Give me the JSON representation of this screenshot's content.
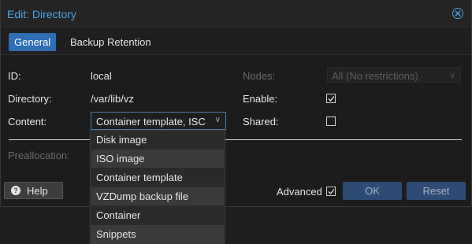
{
  "dialog": {
    "title": "Edit: Directory"
  },
  "tabs": [
    {
      "label": "General",
      "active": true
    },
    {
      "label": "Backup Retention",
      "active": false
    }
  ],
  "form": {
    "id_label": "ID:",
    "id_value": "local",
    "directory_label": "Directory:",
    "directory_value": "/var/lib/vz",
    "content_label": "Content:",
    "content_value": "Container template, ISC",
    "nodes_label": "Nodes:",
    "nodes_value": "All (No restrictions)",
    "enable_label": "Enable:",
    "enable_checked": true,
    "shared_label": "Shared:",
    "shared_checked": false,
    "preallocation_label": "Preallocation:"
  },
  "content_options": [
    "Disk image",
    "ISO image",
    "Container template",
    "VZDump backup file",
    "Container",
    "Snippets"
  ],
  "footer": {
    "help_label": "Help",
    "advanced_label": "Advanced",
    "advanced_checked": true,
    "ok_label": "OK",
    "reset_label": "Reset"
  },
  "colors": {
    "accent": "#4da3e6",
    "active_tab": "#2f6eb5",
    "button_primary": "#2d4b73"
  }
}
